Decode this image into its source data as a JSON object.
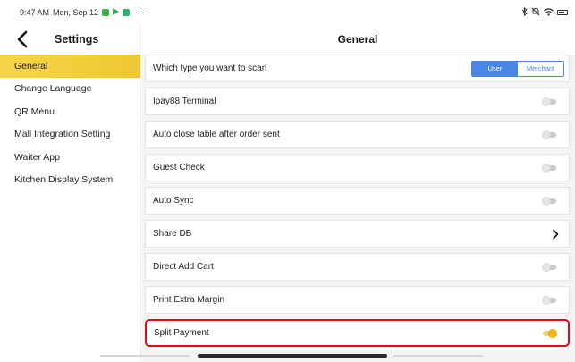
{
  "status_bar": {
    "time": "9:47 AM",
    "date": "Mon, Sep 12",
    "more": "···",
    "icons": [
      "message-app-icon",
      "play-store-icon",
      "app-icon",
      "bluetooth-icon",
      "mute-icon",
      "wifi-icon",
      "battery-icon"
    ]
  },
  "sidebar": {
    "title": "Settings",
    "items": [
      {
        "label": "General",
        "active": true
      },
      {
        "label": "Change Language"
      },
      {
        "label": "QR Menu"
      },
      {
        "label": "Mall Integration Setting"
      },
      {
        "label": "Waiter App"
      },
      {
        "label": "Kitchen Display System"
      }
    ]
  },
  "main": {
    "title": "General",
    "rows": [
      {
        "label": "Which type you want to scan",
        "control": "segmented",
        "options": [
          "User",
          "Merchant"
        ],
        "selected": "User"
      },
      {
        "label": "Ipay88 Terminal",
        "control": "toggle",
        "on": false
      },
      {
        "label": "Auto close table after order sent",
        "control": "toggle",
        "on": false
      },
      {
        "label": "Guest Check",
        "control": "toggle",
        "on": false
      },
      {
        "label": "Auto Sync",
        "control": "toggle",
        "on": false
      },
      {
        "label": "Share DB",
        "control": "chevron"
      },
      {
        "label": "Direct Add Cart",
        "control": "toggle",
        "on": false
      },
      {
        "label": "Print Extra Margin",
        "control": "toggle",
        "on": false
      },
      {
        "label": "Split Payment",
        "control": "toggle",
        "on": true
      }
    ]
  },
  "colors": {
    "accent_yellow": "#f2cd3c",
    "toggle_on": "#f2b817",
    "segment_blue": "#4a86e8",
    "highlight_red": "#d80f16"
  }
}
